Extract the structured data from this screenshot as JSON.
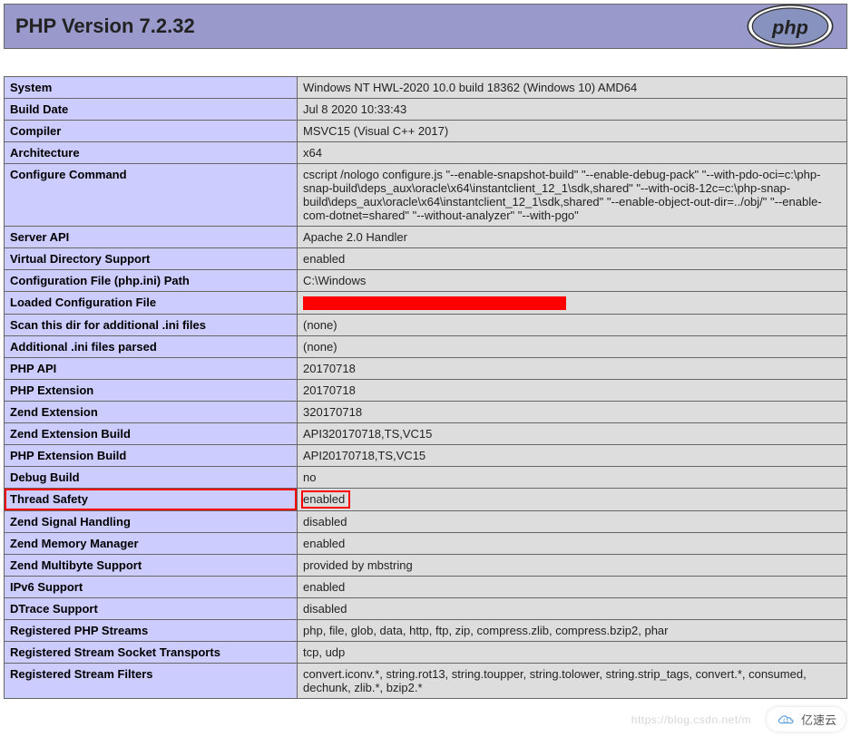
{
  "header": {
    "title": "PHP Version 7.2.32",
    "logo_text": "php"
  },
  "rows": [
    {
      "label": "System",
      "value": "Windows NT HWL-2020 10.0 build 18362 (Windows 10) AMD64"
    },
    {
      "label": "Build Date",
      "value": "Jul 8 2020 10:33:43"
    },
    {
      "label": "Compiler",
      "value": "MSVC15 (Visual C++ 2017)"
    },
    {
      "label": "Architecture",
      "value": "x64"
    },
    {
      "label": "Configure Command",
      "value": "cscript /nologo configure.js \"--enable-snapshot-build\" \"--enable-debug-pack\" \"--with-pdo-oci=c:\\php-snap-build\\deps_aux\\oracle\\x64\\instantclient_12_1\\sdk,shared\" \"--with-oci8-12c=c:\\php-snap-build\\deps_aux\\oracle\\x64\\instantclient_12_1\\sdk,shared\" \"--enable-object-out-dir=../obj/\" \"--enable-com-dotnet=shared\" \"--without-analyzer\" \"--with-pgo\""
    },
    {
      "label": "Server API",
      "value": "Apache 2.0 Handler"
    },
    {
      "label": "Virtual Directory Support",
      "value": "enabled"
    },
    {
      "label": "Configuration File (php.ini) Path",
      "value": "C:\\Windows"
    },
    {
      "label": "Loaded Configuration File",
      "value": "",
      "redacted": true
    },
    {
      "label": "Scan this dir for additional .ini files",
      "value": "(none)"
    },
    {
      "label": "Additional .ini files parsed",
      "value": "(none)"
    },
    {
      "label": "PHP API",
      "value": "20170718"
    },
    {
      "label": "PHP Extension",
      "value": "20170718"
    },
    {
      "label": "Zend Extension",
      "value": "320170718"
    },
    {
      "label": "Zend Extension Build",
      "value": "API320170718,TS,VC15"
    },
    {
      "label": "PHP Extension Build",
      "value": "API20170718,TS,VC15"
    },
    {
      "label": "Debug Build",
      "value": "no"
    },
    {
      "label": "Thread Safety",
      "value": "enabled",
      "highlight": true
    },
    {
      "label": "Zend Signal Handling",
      "value": "disabled"
    },
    {
      "label": "Zend Memory Manager",
      "value": "enabled"
    },
    {
      "label": "Zend Multibyte Support",
      "value": "provided by mbstring"
    },
    {
      "label": "IPv6 Support",
      "value": "enabled"
    },
    {
      "label": "DTrace Support",
      "value": "disabled"
    },
    {
      "label": "Registered PHP Streams",
      "value": "php, file, glob, data, http, ftp, zip, compress.zlib, compress.bzip2, phar"
    },
    {
      "label": "Registered Stream Socket Transports",
      "value": "tcp, udp"
    },
    {
      "label": "Registered Stream Filters",
      "value": "convert.iconv.*, string.rot13, string.toupper, string.tolower, string.strip_tags, convert.*, consumed, dechunk, zlib.*, bzip2.*"
    }
  ],
  "watermark": {
    "text": "亿速云",
    "faint_url": "https://blog.csdn.net/m"
  }
}
